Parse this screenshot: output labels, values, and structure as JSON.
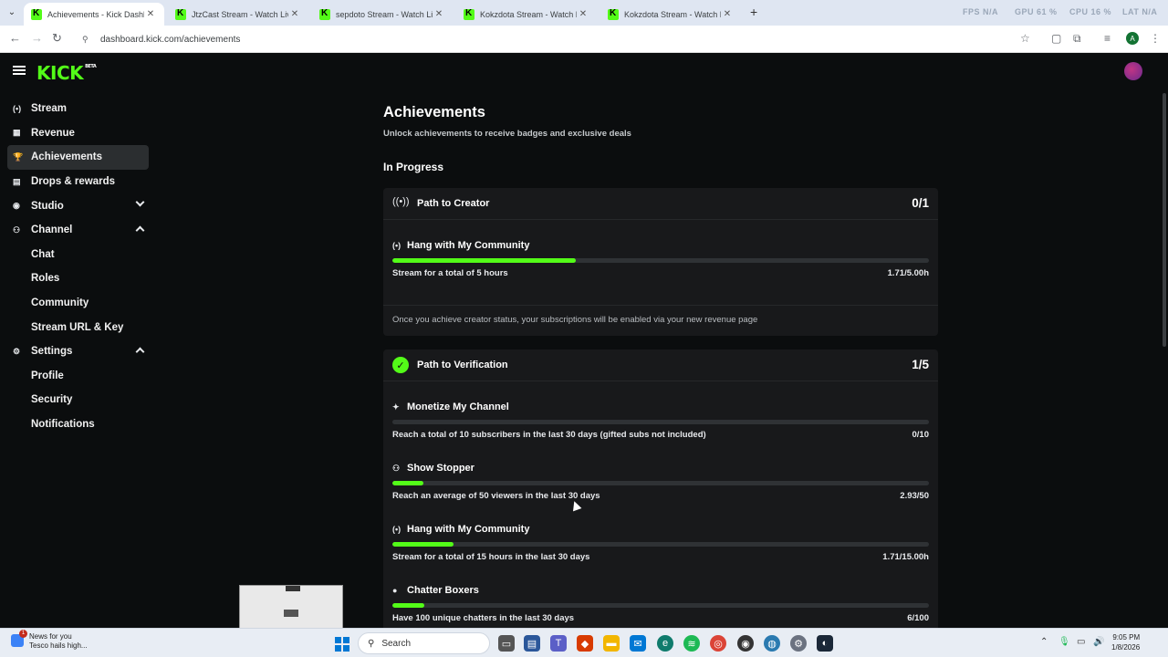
{
  "browser": {
    "tabs": [
      {
        "title": "Achievements - Kick Dashboard",
        "active": true
      },
      {
        "title": "JtzCast Stream - Watch Live on",
        "active": false
      },
      {
        "title": "sepdoto Stream - Watch Live o",
        "active": false
      },
      {
        "title": "Kokzdota Stream - Watch Live c",
        "active": false
      },
      {
        "title": "Kokzdota Stream - Watch Live c",
        "active": false
      }
    ],
    "new_tab": "+",
    "perf": {
      "fps": "FPS  N/A",
      "gpu": "GPU  61 %",
      "cpu": "CPU  16 %",
      "lat": "LAT  N/A"
    },
    "url": "dashboard.kick.com/achievements",
    "profile_initial": "A"
  },
  "app": {
    "logo": "KICK",
    "logo_tag": "BETA",
    "sidebar": [
      {
        "label": "Stream",
        "icon": "broadcast-icon",
        "glyph": "(•)"
      },
      {
        "label": "Revenue",
        "icon": "chart-icon",
        "glyph": "▦"
      },
      {
        "label": "Achievements",
        "icon": "trophy-icon",
        "glyph": "🏆",
        "active": true
      },
      {
        "label": "Drops & rewards",
        "icon": "gift-icon",
        "glyph": "▤"
      },
      {
        "label": "Studio",
        "icon": "studio-icon",
        "glyph": "◉",
        "chevron": "down"
      },
      {
        "label": "Channel",
        "icon": "users-icon",
        "glyph": "⚇",
        "chevron": "up"
      },
      {
        "label": "Chat",
        "sub": true
      },
      {
        "label": "Roles",
        "sub": true
      },
      {
        "label": "Community",
        "sub": true
      },
      {
        "label": "Stream URL & Key",
        "sub": true
      },
      {
        "label": "Settings",
        "icon": "gear-icon",
        "glyph": "⚙",
        "chevron": "up"
      },
      {
        "label": "Profile",
        "sub": true
      },
      {
        "label": "Security",
        "sub": true
      },
      {
        "label": "Notifications",
        "sub": true
      }
    ],
    "page": {
      "title": "Achievements",
      "subtitle": "Unlock achievements to receive badges and exclusive deals",
      "section": "In Progress"
    },
    "cards": [
      {
        "title": "Path to Creator",
        "count": "0/1",
        "icon": "broadcast-icon",
        "achievements": [
          {
            "title": "Hang with My Community",
            "icon": "broadcast-icon",
            "desc": "Stream for a total of 5 hours",
            "value": "1.71/5.00h",
            "progress": 0.342
          }
        ],
        "note": "Once you achieve creator status, your subscriptions will be enabled via your new revenue page"
      },
      {
        "title": "Path to Verification",
        "count": "1/5",
        "icon": "verified-badge-icon",
        "achievements": [
          {
            "title": "Monetize My Channel",
            "icon": "sparkle-icon",
            "desc": "Reach a total of 10 subscribers in the last 30 days (gifted subs not included)",
            "value": "0/10",
            "progress": 0.0
          },
          {
            "title": "Show Stopper",
            "icon": "users-icon",
            "desc": "Reach an average of 50 viewers in the last 30 days",
            "value": "2.93/50",
            "progress": 0.0586
          },
          {
            "title": "Hang with My Community",
            "icon": "broadcast-icon",
            "desc": "Stream for a total of 15 hours in the last 30 days",
            "value": "1.71/15.00h",
            "progress": 0.114
          },
          {
            "title": "Chatter Boxers",
            "icon": "chat-bubble-icon",
            "desc": "Have 100 unique chatters in the last 30 days",
            "value": "6/100",
            "progress": 0.06
          }
        ]
      }
    ]
  },
  "taskbar": {
    "news_title": "News for you",
    "news_sub": "Tesco hails high...",
    "news_badge": "1",
    "search_placeholder": "Search",
    "time": "9:05 PM",
    "date": "1/8/2026"
  },
  "colors": {
    "accent": "#53fc18",
    "bg": "#0b0d0e",
    "card": "#18191b"
  }
}
